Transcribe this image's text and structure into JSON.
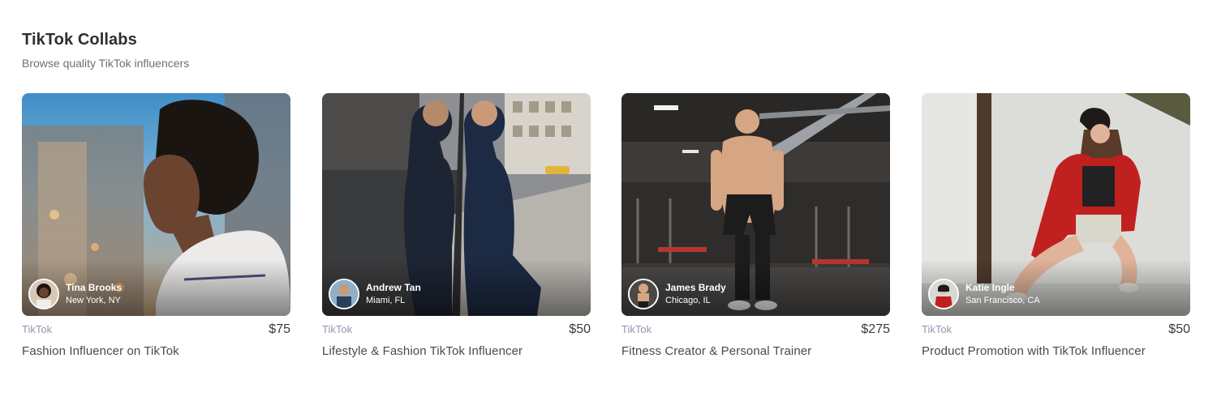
{
  "section": {
    "title": "TikTok Collabs",
    "subtitle": "Browse quality TikTok influencers"
  },
  "cards": [
    {
      "platform": "TikTok",
      "price": "$75",
      "title": "Fashion Influencer on TikTok",
      "creator": {
        "name": "Tina Brooks",
        "location": "New York, NY"
      }
    },
    {
      "platform": "TikTok",
      "price": "$50",
      "title": "Lifestyle & Fashion TikTok Influencer",
      "creator": {
        "name": "Andrew Tan",
        "location": "Miami, FL"
      }
    },
    {
      "platform": "TikTok",
      "price": "$275",
      "title": "Fitness Creator & Personal Trainer",
      "creator": {
        "name": "James Brady",
        "location": "Chicago, IL"
      }
    },
    {
      "platform": "TikTok",
      "price": "$50",
      "title": "Product Promotion with TikTok Influencer",
      "creator": {
        "name": "Katie Ingle",
        "location": "San Francisco, CA"
      }
    }
  ]
}
